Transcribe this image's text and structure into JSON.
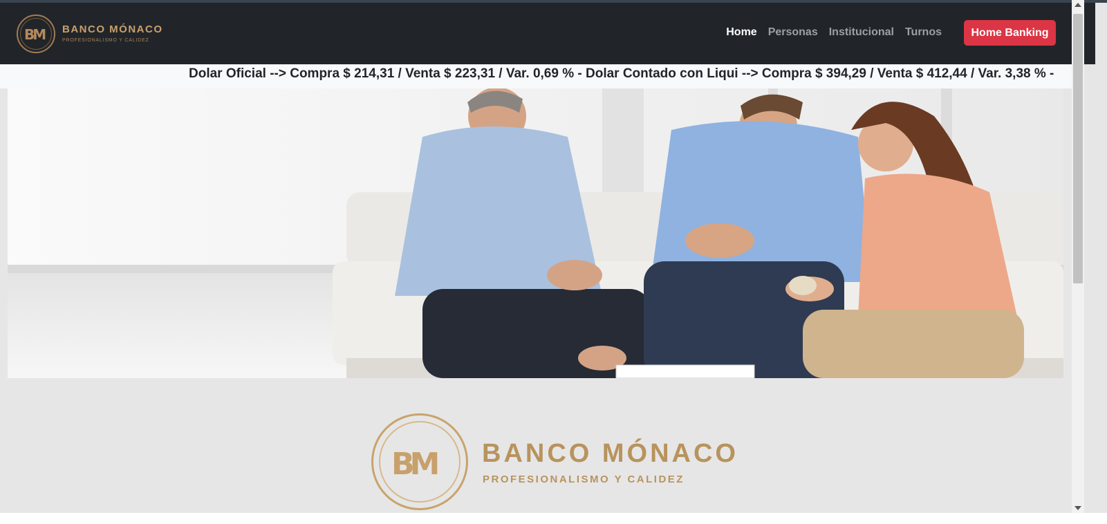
{
  "brand": {
    "monogram": "BM",
    "name": "BANCO MÓNACO",
    "tagline": "PROFESIONALISMO Y CALIDEZ"
  },
  "nav": {
    "items": [
      {
        "label": "Home",
        "active": true
      },
      {
        "label": "Personas",
        "active": false
      },
      {
        "label": "Institucional",
        "active": false
      },
      {
        "label": "Turnos",
        "active": false
      }
    ],
    "cta_label": "Home Banking"
  },
  "ticker": {
    "text": "Dolar Oficial --> Compra $ 214,31 / Venta $ 223,31 / Var. 0,69 % - Dolar Contado con Liqui --> Compra $ 394,29 / Venta $ 412,44 / Var. 3,38 % -"
  },
  "hero": {
    "image": "three-people-consultation-photo"
  },
  "colors": {
    "navbar": "#212529",
    "cta": "#dc3545",
    "gold": "#b8935d",
    "page_bg": "#e6e6e6"
  }
}
